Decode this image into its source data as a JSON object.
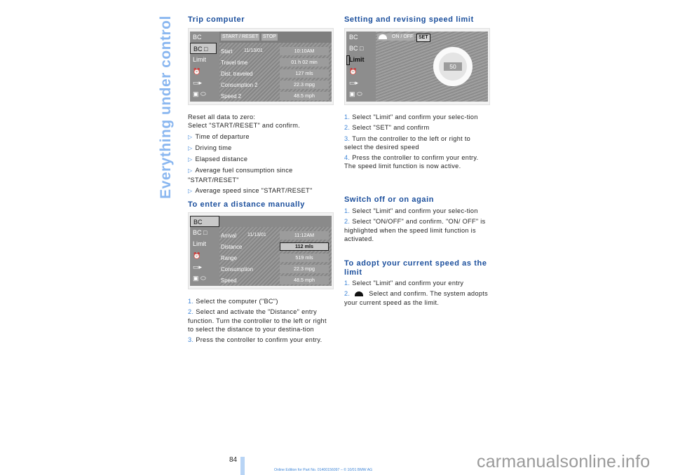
{
  "side_title": "Everything under control",
  "left": {
    "trip_computer": {
      "heading": "Trip computer",
      "screen": {
        "menu": [
          "BC",
          "BC □",
          "Limit",
          "⏰",
          "▭▸",
          "▣ ⬭"
        ],
        "buttons": [
          "START / RESET",
          "STOP"
        ],
        "rows": [
          {
            "label": "Start",
            "date": "11/13/01",
            "value": "10:10AM"
          },
          {
            "label": "Travel time",
            "date": "",
            "value": "01 h 02 min"
          },
          {
            "label": "Dist. traveled",
            "date": "",
            "value": "127 mls"
          },
          {
            "label": "Consumption  2",
            "date": "",
            "value": "22.3 mpg"
          },
          {
            "label": "Speed 2",
            "date": "",
            "value": "48.5 mph"
          }
        ]
      },
      "intro": [
        "Reset all data to zero:",
        "Select \"START/RESET\" and confirm."
      ],
      "bullets": [
        "Time of departure",
        "Driving time",
        "Elapsed distance",
        "Average fuel consumption since \"START/RESET\"",
        "Average speed since \"START/RESET\""
      ]
    },
    "distance": {
      "heading": "To enter a distance manually",
      "screen": {
        "menu": [
          "BC",
          "BC □",
          "Limit",
          "⏰",
          "▭▸",
          "▣ ⬭"
        ],
        "rows": [
          {
            "label": "Arrival",
            "date": "11/13/01",
            "value": "11:12AM"
          },
          {
            "label": "Distance",
            "date": "",
            "value": "112 mls"
          },
          {
            "label": "Range",
            "date": "",
            "value": "519 mls"
          },
          {
            "label": "Consumption",
            "date": "",
            "value": "22.3 mpg"
          },
          {
            "label": "Speed",
            "date": "",
            "value": "48.5 mph"
          }
        ]
      },
      "steps": [
        {
          "n": "1.",
          "text": "Select the computer (\"BC\")"
        },
        {
          "n": "2.",
          "text": "Select and activate the \"Distance\" entry function. Turn the controller to the left or right to select the distance to your destina-tion"
        },
        {
          "n": "3.",
          "text": "Press the controller to confirm your entry."
        }
      ]
    }
  },
  "right": {
    "speed_limit": {
      "heading": "Setting and revising speed limit",
      "screen": {
        "menu": [
          "BC",
          "BC □",
          "Limit",
          "⏰",
          "▭▸",
          "▣ ⬭"
        ],
        "buttons": [
          "ON / OFF",
          "SET"
        ],
        "limit_value": "50"
      },
      "steps": [
        {
          "n": "1.",
          "text": "Select \"Limit\" and confirm your selec-tion"
        },
        {
          "n": "2.",
          "text": "Select \"SET\" and confirm"
        },
        {
          "n": "3.",
          "text": "Turn the controller to the left or right to select the desired speed"
        },
        {
          "n": "4.",
          "text": "Press the controller to confirm your entry. The speed limit function is now active."
        }
      ]
    },
    "switch": {
      "heading": "Switch off or on again",
      "steps": [
        {
          "n": "1.",
          "text": "Select \"Limit\" and confirm your selec-tion"
        },
        {
          "n": "2.",
          "text": "Select \"ON/OFF\" and confirm. \"ON/ OFF\" is highlighted when the speed limit function is activated."
        }
      ]
    },
    "adopt": {
      "heading": "To adopt your current speed as the limit",
      "steps": [
        {
          "n": "1.",
          "text": "Select \"Limit\" and confirm your entry"
        },
        {
          "n": "2.",
          "text": "Select and confirm. The system adopts your current speed as the limit."
        }
      ]
    }
  },
  "footer": {
    "page_number": "84",
    "edition": "Online Edition for Part No. 01400156097 – © 10/01 BMW AG",
    "watermark": "carmanualsonline.info"
  }
}
